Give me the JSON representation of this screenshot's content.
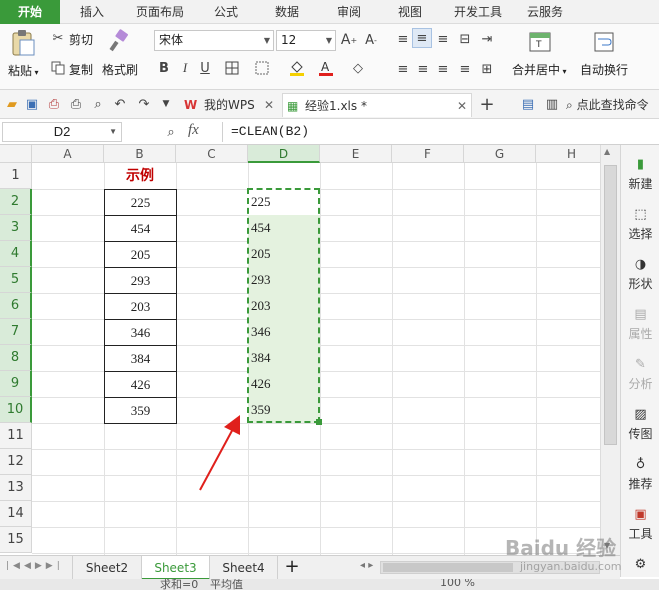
{
  "ribbon": {
    "tabs": [
      "开始",
      "插入",
      "页面布局",
      "公式",
      "数据",
      "审阅",
      "视图",
      "开发工具",
      "云服务"
    ],
    "active_tab": "开始"
  },
  "toolbar": {
    "paste_label": "粘贴",
    "cut_label": "剪切",
    "copy_label": "复制",
    "format_painter_label": "格式刷",
    "font_name": "宋体",
    "font_size": "12",
    "merge_center_label": "合并居中",
    "wrap_text_label": "自动换行",
    "bold": "B",
    "italic": "I",
    "underline": "U"
  },
  "quick_access": {
    "doc_tabs": [
      {
        "label": "我的WPS"
      },
      {
        "label": "经验1.xls *"
      }
    ],
    "search_label": "点此查找命令"
  },
  "formula_bar": {
    "name_box": "D2",
    "fx_label": "fx",
    "formula": "=CLEAN(B2)"
  },
  "grid": {
    "columns": [
      "A",
      "B",
      "C",
      "D",
      "E",
      "F",
      "G",
      "H"
    ],
    "rows": [
      "1",
      "2",
      "3",
      "4",
      "5",
      "6",
      "7",
      "8",
      "9",
      "10",
      "11",
      "12",
      "13",
      "14",
      "15"
    ],
    "header_cell": "示例",
    "header_color": "#c00000",
    "b_values": [
      "225",
      "454",
      "205",
      "293",
      "203",
      "346",
      "384",
      "426",
      "359"
    ],
    "d_values": [
      "225",
      "454",
      "205",
      "293",
      "203",
      "346",
      "384",
      "426",
      "359"
    ],
    "selection_color": "#3a9a3a",
    "arrow_color": "#e0201c"
  },
  "right_panel": {
    "items": [
      {
        "label": "新建",
        "icon": "new-icon"
      },
      {
        "label": "选择",
        "icon": "select-icon"
      },
      {
        "label": "形状",
        "icon": "shape-icon"
      },
      {
        "label": "属性",
        "icon": "property-icon"
      },
      {
        "label": "分析",
        "icon": "analysis-icon"
      },
      {
        "label": "传图",
        "icon": "upload-image-icon"
      },
      {
        "label": "推荐",
        "icon": "recommend-icon"
      },
      {
        "label": "工具",
        "icon": "toolbox-icon"
      }
    ]
  },
  "sheets": {
    "tabs": [
      "Sheet2",
      "Sheet3",
      "Sheet4"
    ],
    "active": "Sheet3",
    "add_label": "+"
  },
  "status": {
    "sum_label": "求和=0",
    "avg_label": "平均值",
    "zoom": "100 %"
  },
  "watermark": {
    "text": "Baidu 经验",
    "url_text": "jingyan.baidu.com"
  }
}
